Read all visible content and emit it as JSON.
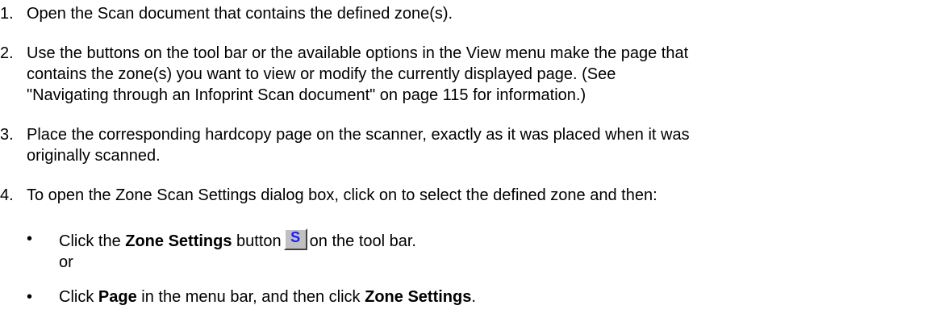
{
  "steps": [
    {
      "number": "1.",
      "lines": [
        "Open the Scan document that contains the defined zone(s)."
      ]
    },
    {
      "number": "2.",
      "lines": [
        "Use the buttons on the tool bar or the available options in the View menu make the page that",
        "contains the zone(s) you want to view or modify the currently displayed page. (See",
        "\"Navigating through an Infoprint Scan document\" on page 115 for information.)"
      ]
    },
    {
      "number": "3.",
      "lines": [
        "Place the corresponding hardcopy page on the scanner, exactly as it was placed when it was",
        "originally scanned."
      ]
    },
    {
      "number": "4.",
      "lines": [
        "To open the Zone Scan Settings dialog box, click on to select the defined zone and then:"
      ]
    }
  ],
  "bullets": {
    "first": {
      "prefix": "Click the ",
      "bold": "Zone Settings",
      "middle": " button",
      "icon_glyph": "S",
      "icon_name": "zone-settings-icon",
      "suffix": "on the tool bar.",
      "or": "or"
    },
    "second": {
      "prefix": "Click ",
      "bold1": "Page",
      "middle": " in the menu bar, and then click ",
      "bold2": "Zone Settings",
      "suffix": "."
    }
  }
}
